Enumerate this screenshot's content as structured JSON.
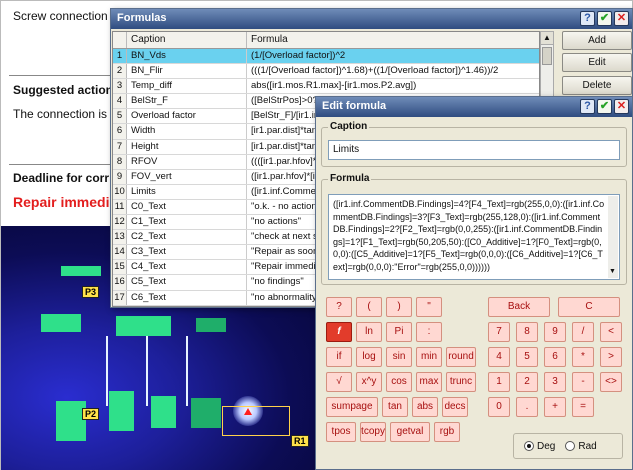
{
  "report": {
    "line1": "Screw connection i",
    "heading_action": "Suggested action",
    "line3": "The connection is",
    "heading_deadline": "Deadline for corr",
    "repair": "Repair immedi"
  },
  "thermal_markers": [
    "P3",
    "P2",
    "R1"
  ],
  "formulas_window": {
    "title": "Formulas",
    "columns": [
      "Caption",
      "Formula"
    ],
    "rows": [
      {
        "n": "1",
        "caption": "BN_Vds",
        "formula": "(1/[Overload factor])^2"
      },
      {
        "n": "2",
        "caption": "BN_Flir",
        "formula": "(((1/[Overload factor])^1.68)+((1/[Overload factor])^1.46))/2"
      },
      {
        "n": "3",
        "caption": "Temp_diff",
        "formula": "abs([ir1.mos.R1.max]-[ir1.mos.P2.avg])"
      },
      {
        "n": "4",
        "caption": "BelStr_F",
        "formula": "([BelStrPos]>0?dd"
      },
      {
        "n": "5",
        "caption": "Overload factor",
        "formula": "[BelStr_F]/[ir1.inf"
      },
      {
        "n": "6",
        "caption": "Width",
        "formula": "[ir1.par.dist]*tanc"
      },
      {
        "n": "7",
        "caption": "Height",
        "formula": "[ir1.par.dist]*tanc"
      },
      {
        "n": "8",
        "caption": "RFOV",
        "formula": "((([ir1.par.hfov]*[ir"
      },
      {
        "n": "9",
        "caption": "FOV_vert",
        "formula": "([ir1.par.hfov]*[ir1"
      },
      {
        "n": "10",
        "caption": "Limits",
        "formula": "([ir1.inf.Comment"
      },
      {
        "n": "11",
        "caption": "C0_Text",
        "formula": "\"o.k. - no actions"
      },
      {
        "n": "12",
        "caption": "C1_Text",
        "formula": "\"no actions\""
      },
      {
        "n": "13",
        "caption": "C2_Text",
        "formula": "\"check at next so"
      },
      {
        "n": "14",
        "caption": "C3_Text",
        "formula": "\"Repair as soon a"
      },
      {
        "n": "15",
        "caption": "C4_Text",
        "formula": "\"Repair immedia"
      },
      {
        "n": "16",
        "caption": "C5_Text",
        "formula": "\"no findings\""
      },
      {
        "n": "17",
        "caption": "C6_Text",
        "formula": "\"no abnormality\""
      }
    ],
    "selected_row": 1,
    "buttons": {
      "add": "Add",
      "edit": "Edit",
      "delete": "Delete"
    }
  },
  "edit_dialog": {
    "title": "Edit formula",
    "caption_label": "Caption",
    "caption_value": "Limits",
    "formula_label": "Formula",
    "formula_value": "([ir1.inf.CommentDB.Findings]=4?[F4_Text]=rgb(255,0,0):([ir1.inf.CommentDB.Findings]=3?[F3_Text]=rgb(255,128,0):([ir1.inf.CommentDB.Findings]=2?[F2_Text]=rgb(0,0,255):([ir1.inf.CommentDB.Findings]=1?[F1_Text]=rgb(50,205,50):([C0_Additive]=1?[F0_Text]=rgb(0,0,0):([C5_Additive]=1?[F5_Text]=rgb(0,0,0):([C6_Additive]=1?[C6_Text]=rgb(0,0,0):\"Error\"=rgb(255,0,0))))))",
    "keys_left": [
      [
        "?",
        "(",
        ")",
        "\""
      ],
      [
        "f",
        "ln",
        "Pi",
        ":"
      ],
      [
        "if",
        "log",
        "sin",
        "min",
        "round"
      ],
      [
        "√",
        "x^y",
        "cos",
        "max",
        "trunc"
      ],
      [
        "sumpage",
        "tan",
        "abs",
        "decs"
      ],
      [
        "tpos",
        "tcopy",
        "getval",
        "rgb"
      ]
    ],
    "keys_right": [
      [
        "Back",
        "C"
      ],
      [
        "7",
        "8",
        "9",
        "/",
        "<"
      ],
      [
        "4",
        "5",
        "6",
        "*",
        ">"
      ],
      [
        "1",
        "2",
        "3",
        "-",
        "<>"
      ],
      [
        "0",
        ".",
        "+",
        "="
      ]
    ],
    "angle_mode": {
      "deg": "Deg",
      "rad": "Rad",
      "selected": "deg"
    }
  },
  "colors": {
    "selected_row": "#6ad1ef",
    "key_fill": "#ffd8d2",
    "repair_text": "#e31e1e"
  },
  "icons": [
    "help-icon",
    "ok-checkmark-icon",
    "close-icon"
  ]
}
